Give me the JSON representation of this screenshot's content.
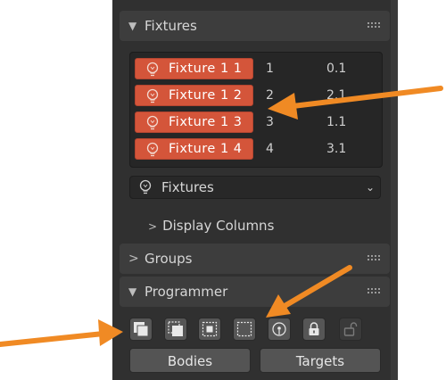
{
  "fixtures_panel": {
    "title": "Fixtures",
    "rows": [
      {
        "name": "Fixture 1 1",
        "number": "1",
        "version": "0.1"
      },
      {
        "name": "Fixture 1 2",
        "number": "2",
        "version": "2.1"
      },
      {
        "name": "Fixture 1 3",
        "number": "3",
        "version": "1.1"
      },
      {
        "name": "Fixture 1 4",
        "number": "4",
        "version": "3.1"
      }
    ],
    "dropdown_value": "Fixtures",
    "display_columns_label": "Display Columns"
  },
  "groups_panel": {
    "title": "Groups"
  },
  "programmer_panel": {
    "title": "Programmer",
    "tools": [
      "select-all-icon",
      "deselect-icon",
      "select-center-icon",
      "box-select-icon",
      "select-target-icon",
      "lock-icon",
      "unlock-icon"
    ],
    "buttons": {
      "bodies": "Bodies",
      "targets": "Targets"
    }
  },
  "colors": {
    "accent": "#d4553a",
    "annotation_arrow": "#f08a24",
    "panel_bg": "#303030",
    "header_bg": "#3d3d3d"
  }
}
